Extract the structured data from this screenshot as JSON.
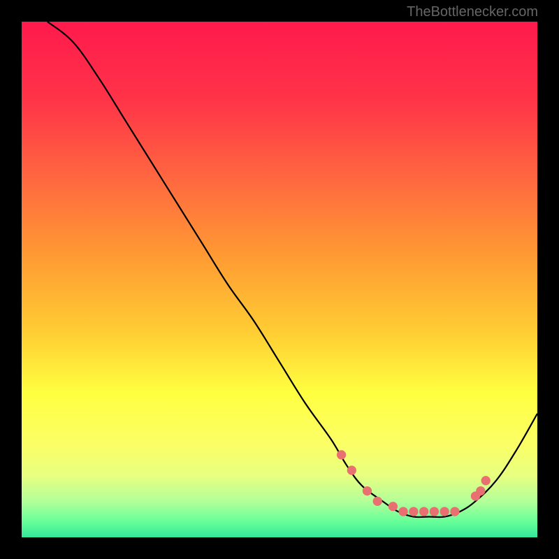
{
  "attribution": "TheBottlenecker.com",
  "chart_data": {
    "type": "line",
    "title": "",
    "xlabel": "",
    "ylabel": "",
    "xlim": [
      0,
      100
    ],
    "ylim": [
      0,
      100
    ],
    "series": [
      {
        "name": "bottleneck-curve",
        "x": [
          5,
          10,
          15,
          20,
          25,
          30,
          35,
          40,
          45,
          50,
          55,
          60,
          63,
          66,
          70,
          73,
          76,
          79,
          82,
          85,
          88,
          92,
          96,
          100
        ],
        "y": [
          100,
          96,
          89,
          81,
          73,
          65,
          57,
          49,
          42,
          34,
          26,
          19,
          14,
          10,
          7,
          5,
          4,
          4,
          4,
          5,
          7,
          11,
          17,
          24
        ]
      }
    ],
    "markers": {
      "x": [
        62,
        64,
        67,
        69,
        72,
        74,
        76,
        78,
        80,
        82,
        84,
        88,
        89,
        90
      ],
      "y": [
        16,
        13,
        9,
        7,
        6,
        5,
        5,
        5,
        5,
        5,
        5,
        8,
        9,
        11
      ]
    },
    "gradient_stops": [
      {
        "offset": 0,
        "color": "#ff1a4d"
      },
      {
        "offset": 15,
        "color": "#ff3348"
      },
      {
        "offset": 30,
        "color": "#ff6640"
      },
      {
        "offset": 45,
        "color": "#ff9933"
      },
      {
        "offset": 60,
        "color": "#ffcc33"
      },
      {
        "offset": 72,
        "color": "#ffff40"
      },
      {
        "offset": 82,
        "color": "#fbff66"
      },
      {
        "offset": 88,
        "color": "#e8ff80"
      },
      {
        "offset": 93,
        "color": "#b3ff99"
      },
      {
        "offset": 97,
        "color": "#66ff99"
      },
      {
        "offset": 100,
        "color": "#33e699"
      }
    ]
  }
}
